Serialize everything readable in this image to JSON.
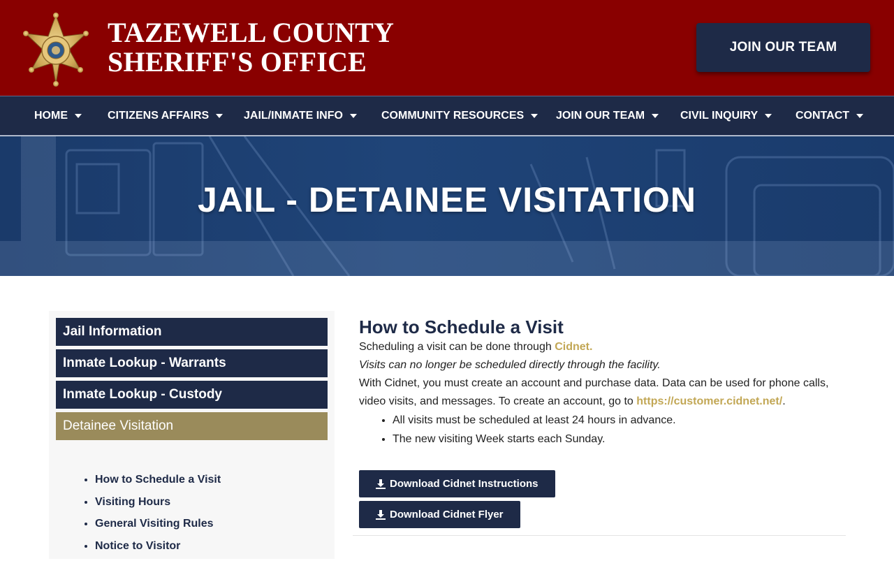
{
  "header": {
    "title_line1": "TAZEWELL COUNTY",
    "title_line2": "SHERIFF'S OFFICE",
    "join_button": "JOIN OUR TEAM"
  },
  "nav": {
    "items": [
      {
        "label": "HOME"
      },
      {
        "label": "CITIZENS AFFAIRS"
      },
      {
        "label": "JAIL/INMATE INFO"
      },
      {
        "label": "COMMUNITY RESOURCES"
      },
      {
        "label": "JOIN OUR TEAM"
      },
      {
        "label": "CIVIL INQUIRY"
      },
      {
        "label": "CONTACT"
      }
    ]
  },
  "hero": {
    "title": "JAIL - DETAINEE VISITATION"
  },
  "sidebar": {
    "buttons": [
      {
        "label": "Jail Information"
      },
      {
        "label": "Inmate Lookup - Warrants"
      },
      {
        "label": "Inmate Lookup - Custody"
      },
      {
        "label": "Detainee Visitation"
      }
    ],
    "links": [
      {
        "label": "How to Schedule a Visit"
      },
      {
        "label": "Visiting Hours"
      },
      {
        "label": "General Visiting Rules"
      },
      {
        "label": "Notice to Visitor"
      }
    ]
  },
  "main": {
    "heading": "How to Schedule a Visit",
    "p1_text": "Scheduling a visit can be done through ",
    "p1_link": "Cidnet.",
    "p2_italic": "Visits can no longer be scheduled directly through the facility.",
    "p3_text": "With Cidnet, you must create an account and purchase data. Data can be used for phone calls, video visits, and messages. To create an account, go to ",
    "p3_link": "https://customer.cidnet.net/",
    "p3_end": ".",
    "bullets": [
      "All visits must be scheduled at least 24 hours in advance.",
      "The new visiting Week starts each Sunday."
    ],
    "download_instructions": "Download Cidnet Instructions",
    "download_flyer": "Download Cidnet Flyer"
  },
  "colors": {
    "header_red": "#890000",
    "navy": "#1e2a47",
    "gold": "#9a8b5b",
    "link_gold": "#c2a755"
  }
}
